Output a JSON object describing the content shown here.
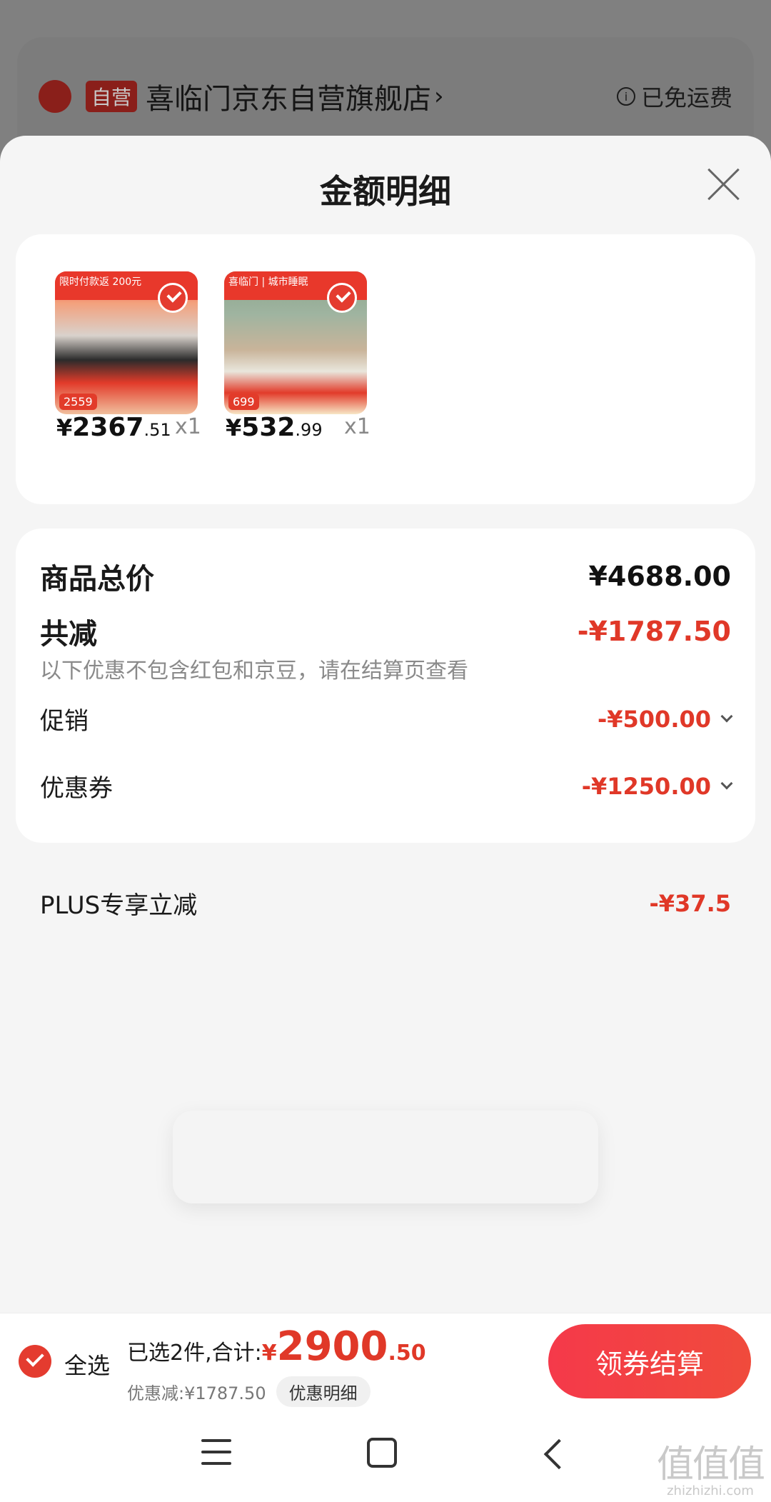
{
  "background_store": {
    "badge": "自营",
    "name": "喜临门京东自营旗舰店",
    "chevron": "›",
    "shipping": "已免运费",
    "info_icon": "i"
  },
  "sheet": {
    "title": "金额明细"
  },
  "products": [
    {
      "image_banner": "限时付款返 200元",
      "image_price_tag": "2559",
      "price_symbol": "¥",
      "price_int": "2367",
      "price_dec": ".51",
      "qty": "x1"
    },
    {
      "image_banner": "喜临门 | 城市睡眠",
      "image_price_tag": "699",
      "price_symbol": "¥",
      "price_int": "532",
      "price_dec": ".99",
      "qty": "x1"
    }
  ],
  "summary": {
    "total_label": "商品总价",
    "total_value": "¥4688.00",
    "reduce_label": "共减",
    "reduce_value": "-¥1787.50",
    "note": "以下优惠不包含红包和京豆，请在结算页查看",
    "promo_label": "促销",
    "promo_value": "-¥500.00",
    "coupon_label": "优惠券",
    "coupon_value": "-¥1250.00",
    "plus_label": "PLUS专享立减",
    "plus_value": "-¥37.5"
  },
  "bottom_bar": {
    "select_all": "全选",
    "selected_prefix": "已选2件,合计:",
    "total_symbol": "¥",
    "total_int": "2900",
    "total_dec": ".50",
    "discount_text": "优惠减:¥1787.50",
    "discount_detail": "优惠明细",
    "checkout": "领券结算"
  },
  "watermark": {
    "big": "值值值",
    "small": "zhizhizhi.com"
  },
  "colors": {
    "accent_red": "#e03828",
    "checkout_gradient_start": "#f5394a",
    "checkout_gradient_end": "#f04b3c"
  }
}
